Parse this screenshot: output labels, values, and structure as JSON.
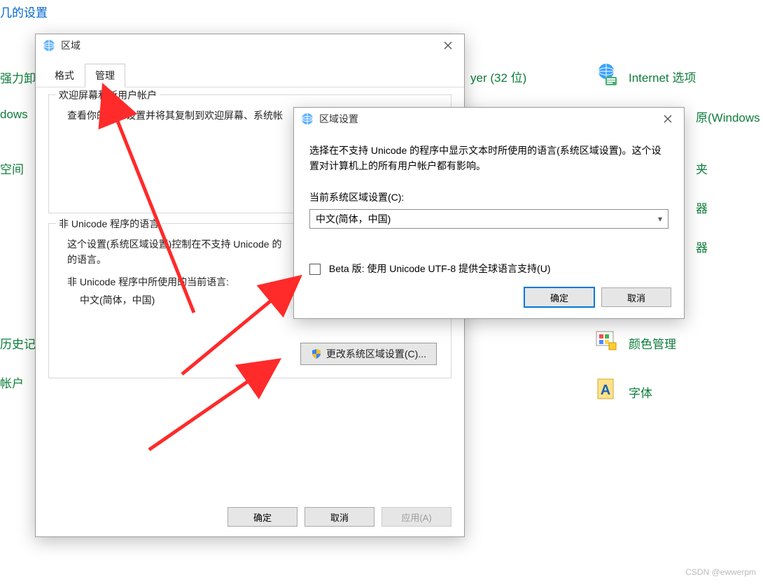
{
  "page": {
    "heading": "几的设置",
    "watermark": "CSDN @ewwerpm"
  },
  "bg_links": {
    "l1": "强力卸",
    "l2": "dows",
    "l3": "空间",
    "l4": "历史记",
    "l5": "帐户",
    "l6": "yer (32 位)",
    "l7": "Internet 选项",
    "l8": "原(Windows",
    "l9": "夹",
    "l10": "器",
    "l11": "器",
    "l12": "颜色管理",
    "l13": "字体"
  },
  "region_dialog": {
    "title": "区域",
    "tabs": {
      "format": "格式",
      "admin": "管理"
    },
    "welcome_group": {
      "title": "欢迎屏幕和新用户帐户",
      "desc": "查看你的国际设置并将其复制到欢迎屏幕、系统帐"
    },
    "unicode_group": {
      "title": "非 Unicode 程序的语言",
      "desc1": "这个设置(系统区域设置)控制在不支持 Unicode 的",
      "desc2": "的语言。",
      "label": "非 Unicode 程序中所使用的当前语言:",
      "value": "中文(简体，中国)",
      "change_btn": "更改系统区域设置(C)..."
    },
    "ok": "确定",
    "cancel": "取消",
    "apply": "应用(A)"
  },
  "locale_dialog": {
    "title": "区域设置",
    "desc": "选择在不支持 Unicode 的程序中显示文本时所使用的语言(系统区域设置)。这个设置对计算机上的所有用户帐户都有影响。",
    "label": "当前系统区域设置(C):",
    "selected": "中文(简体，中国)",
    "checkbox": "Beta 版: 使用 Unicode UTF-8 提供全球语言支持(U)",
    "ok": "确定",
    "cancel": "取消"
  }
}
